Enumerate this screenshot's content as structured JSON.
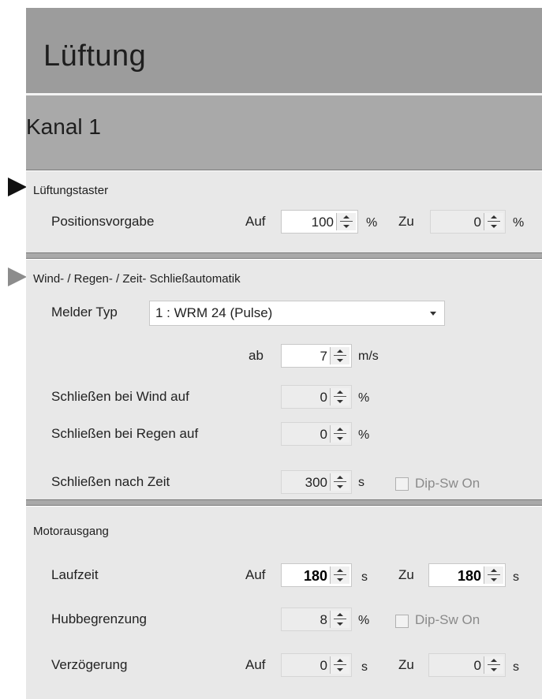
{
  "header": {
    "title": "Lüftung"
  },
  "channel": {
    "title": "Kanal 1"
  },
  "luftungstaster": {
    "title": "Lüftungstaster",
    "position_label": "Positionsvorgabe",
    "auf_label": "Auf",
    "auf_value": "100",
    "auf_unit": "%",
    "zu_label": "Zu",
    "zu_value": "0",
    "zu_unit": "%"
  },
  "schliessautomatik": {
    "title": "Wind- / Regen- / Zeit- Schließautomatik",
    "melder_label": "Melder Typ",
    "melder_value": "1 : WRM 24   (Pulse)",
    "ab_label": "ab",
    "ab_value": "7",
    "ab_unit": "m/s",
    "wind_label": "Schließen bei Wind auf",
    "wind_value": "0",
    "wind_unit": "%",
    "regen_label": "Schließen bei Regen auf",
    "regen_value": "0",
    "regen_unit": "%",
    "zeit_label": "Schließen nach Zeit",
    "zeit_value": "300",
    "zeit_unit": "s",
    "dip_label": "Dip-Sw On",
    "dip_checked": false
  },
  "motorausgang": {
    "title": "Motorausgang",
    "laufzeit_label": "Laufzeit",
    "laufzeit_auf_label": "Auf",
    "laufzeit_auf_value": "180",
    "laufzeit_auf_unit": "s",
    "laufzeit_zu_label": "Zu",
    "laufzeit_zu_value": "180",
    "laufzeit_zu_unit": "s",
    "hub_label": "Hubbegrenzung",
    "hub_value": "8",
    "hub_unit": "%",
    "hub_dip_label": "Dip-Sw On",
    "hub_dip_checked": false,
    "verz_label": "Verzögerung",
    "verz_auf_label": "Auf",
    "verz_auf_value": "0",
    "verz_auf_unit": "s",
    "verz_zu_label": "Zu",
    "verz_zu_value": "0",
    "verz_zu_unit": "s"
  },
  "colors": {
    "header_bg": "#9c9c9c",
    "subheader_bg": "#a9a9a9",
    "panel_bg": "#e8e8e8",
    "pointer_active": "#111111",
    "pointer_inactive": "#8c8c8c"
  }
}
